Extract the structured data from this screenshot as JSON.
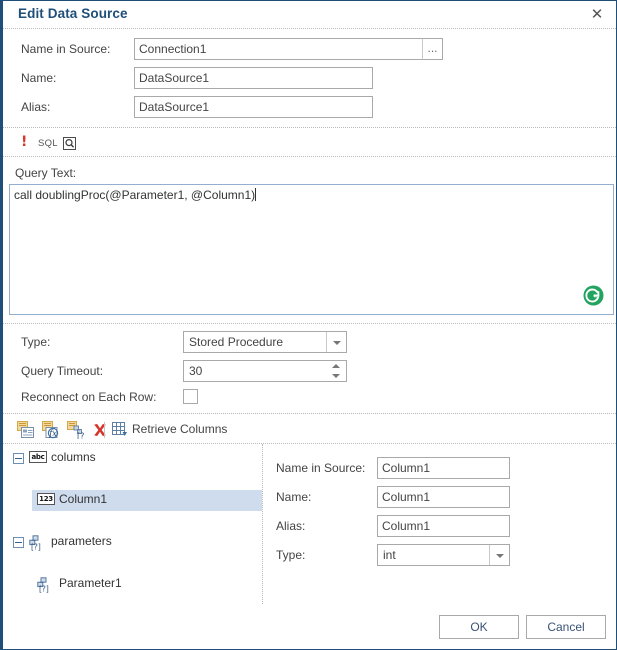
{
  "dialog": {
    "title": "Edit Data Source",
    "close_icon": "close-icon",
    "accent_color": "#1f4e79"
  },
  "source_fields": [
    {
      "label": "Name in Source:",
      "value": "Connection1",
      "browse_label": "..."
    },
    {
      "label": "Name:",
      "value": "DataSource1"
    },
    {
      "label": "Alias:",
      "value": "DataSource1"
    }
  ],
  "sql_toolbar": {
    "error_icon": "exclamation-icon",
    "sql_label": "SQL",
    "preview_icon": "query-preview-icon"
  },
  "query": {
    "label": "Query Text:",
    "text": "call doublingProc(@Parameter1, @Column1)",
    "refresh_icon": "refresh-icon",
    "refresh_color": "#22a35f"
  },
  "settings": [
    {
      "label": "Type:",
      "value": "Stored Procedure",
      "kind": "combo"
    },
    {
      "label": "Query Timeout:",
      "value": "30",
      "kind": "spinner"
    },
    {
      "label": "Reconnect on Each Row:",
      "value": "",
      "kind": "checkbox",
      "checked": false
    }
  ],
  "columns_toolbar": {
    "icons": [
      {
        "name": "add-column-icon"
      },
      {
        "name": "add-expression-column-icon"
      },
      {
        "name": "add-parameter-icon"
      },
      {
        "name": "delete-icon"
      }
    ],
    "retrieve_icon": "retrieve-columns-icon",
    "retrieve_label": "Retrieve Columns"
  },
  "tree": {
    "nodes": [
      {
        "label": "columns",
        "icon": "abc-icon",
        "badge": "abc",
        "depth": 0,
        "expanded": true,
        "selected": false
      },
      {
        "label": "Column1",
        "icon": "123-icon",
        "badge": "123",
        "depth": 1,
        "expanded": null,
        "selected": true
      },
      {
        "label": "parameters",
        "icon": "parameter-icon",
        "badge": "[?]",
        "depth": 0,
        "expanded": true,
        "selected": false
      },
      {
        "label": "Parameter1",
        "icon": "parameter-icon",
        "badge": "[?]",
        "depth": 1,
        "expanded": null,
        "selected": false
      }
    ],
    "selection_color": "#cfdcee"
  },
  "details": [
    {
      "label": "Name in Source:",
      "value": "Column1",
      "kind": "text"
    },
    {
      "label": "Name:",
      "value": "Column1",
      "kind": "text"
    },
    {
      "label": "Alias:",
      "value": "Column1",
      "kind": "text"
    },
    {
      "label": "Type:",
      "value": "int",
      "kind": "combo"
    }
  ],
  "footer": {
    "ok_label": "OK",
    "cancel_label": "Cancel"
  }
}
